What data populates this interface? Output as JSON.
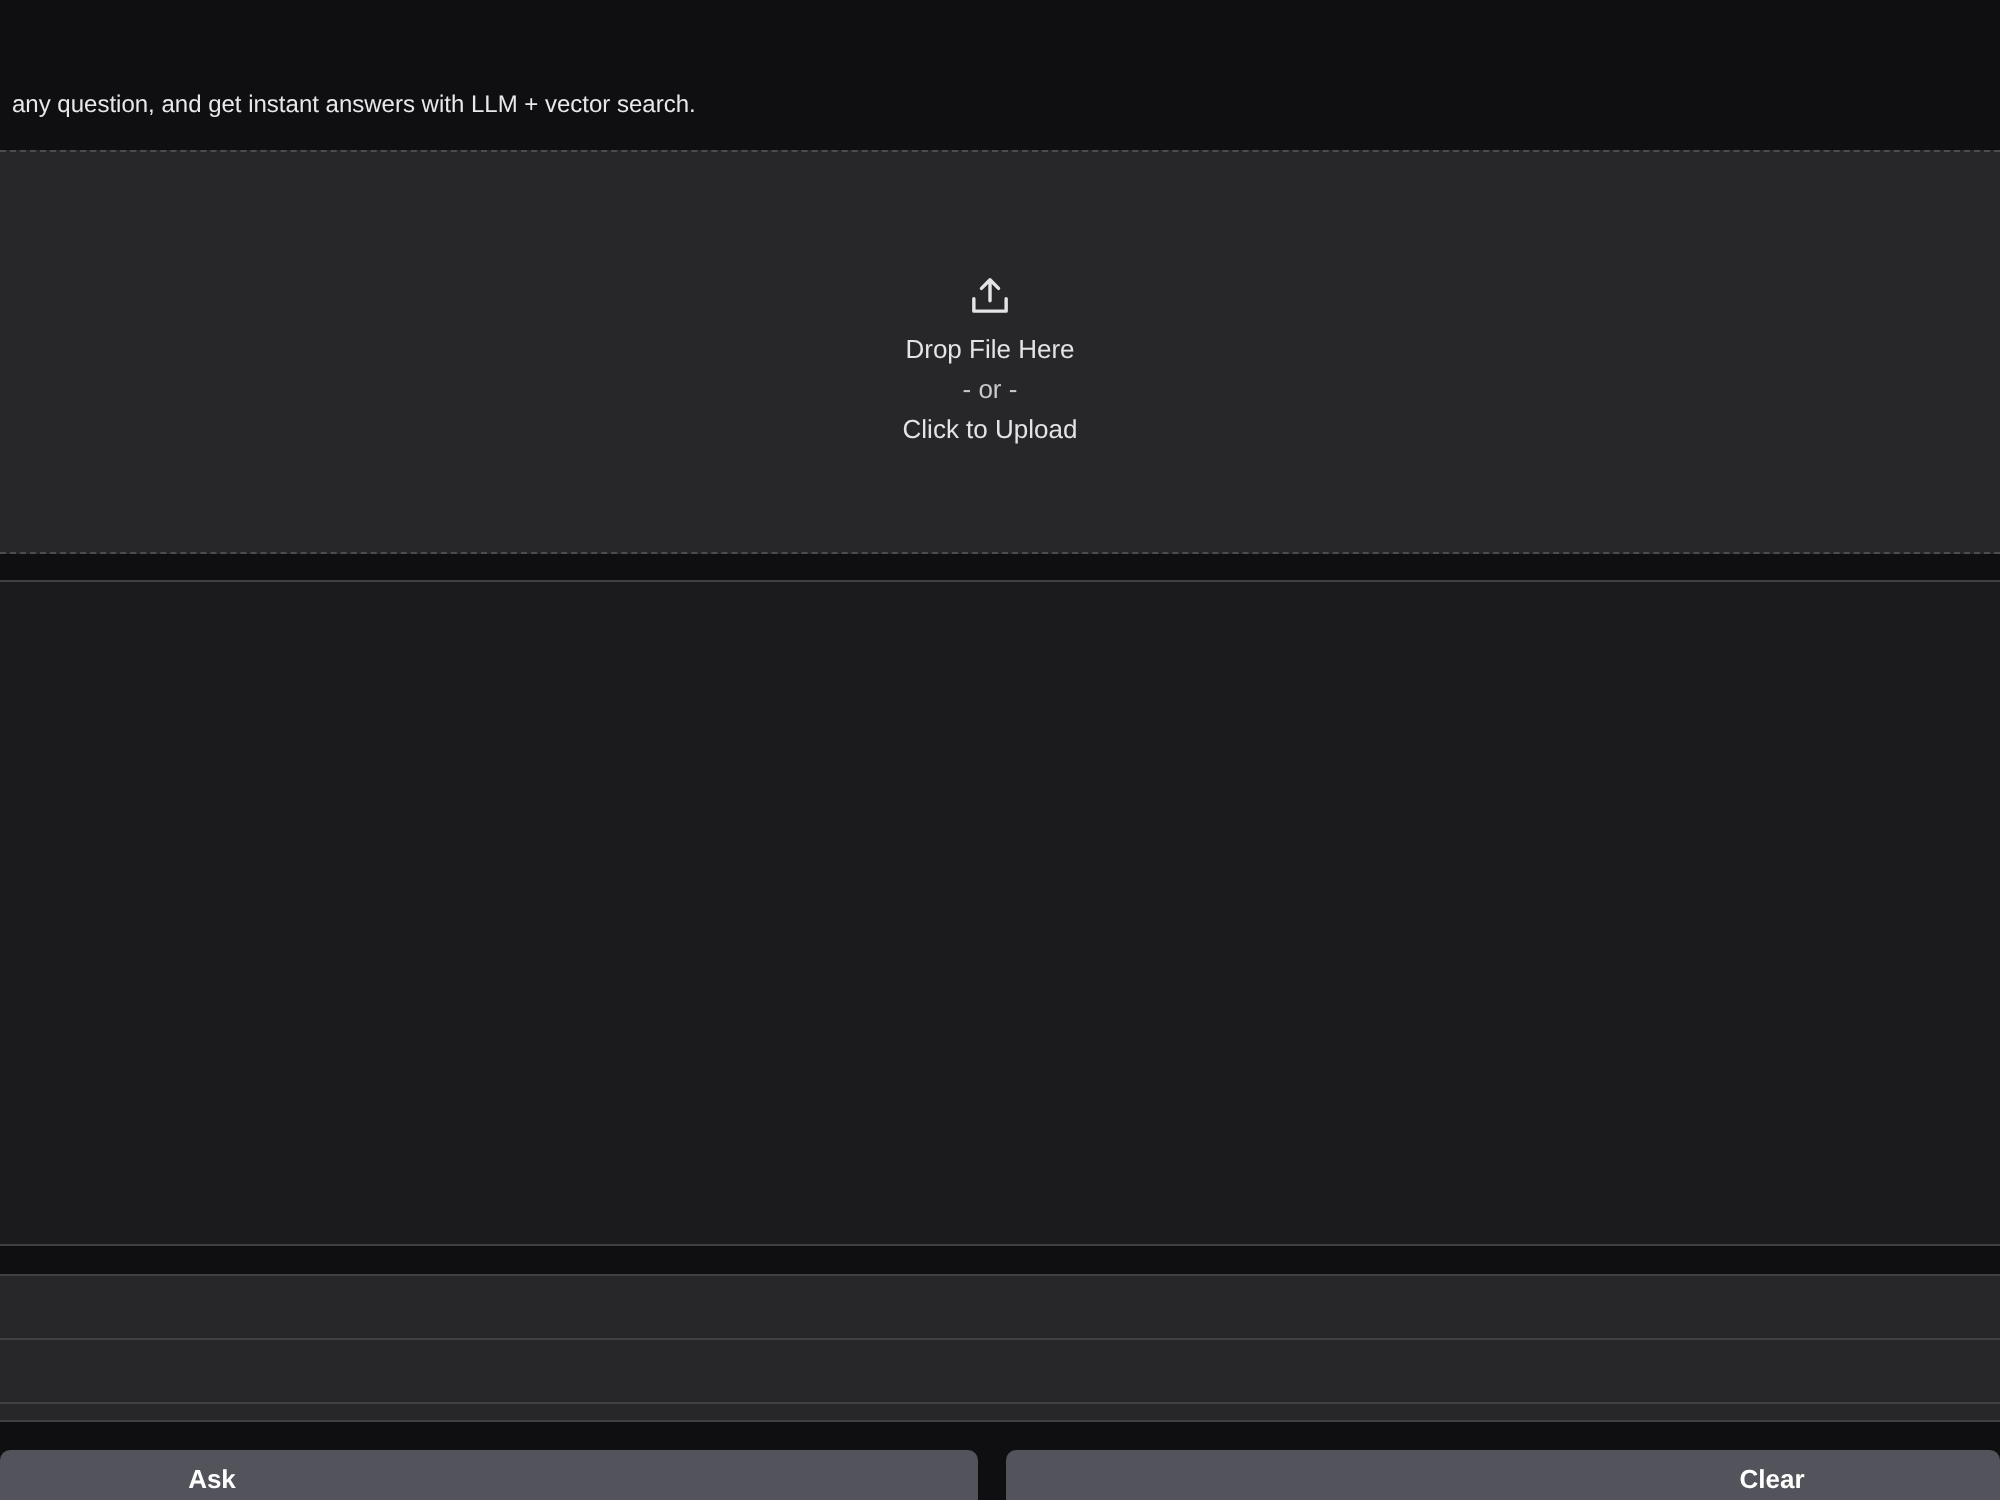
{
  "description": "any question, and get instant answers with LLM + vector search.",
  "upload": {
    "title": "Drop File Here",
    "separator": "- or -",
    "action": "Click to Upload"
  },
  "inputs": [
    {
      "kind": "textbox"
    },
    {
      "kind": "textbox"
    }
  ],
  "buttons": [
    {
      "label": "Ask"
    },
    {
      "label": "Clear"
    }
  ]
}
